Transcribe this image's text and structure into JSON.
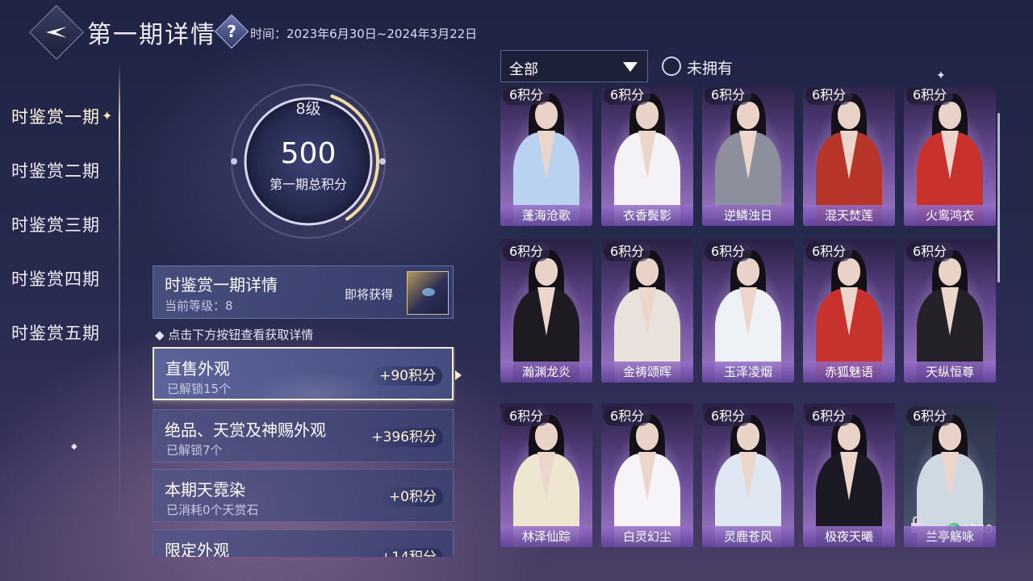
{
  "header": {
    "title": "第一期详情",
    "help_symbol": "?",
    "time_range": "时间：2023年6月30日~2024年3月22日"
  },
  "nav": {
    "items": [
      {
        "label": "时鉴赏一期",
        "active": true
      },
      {
        "label": "时鉴赏二期",
        "active": false
      },
      {
        "label": "时鉴赏三期",
        "active": false
      },
      {
        "label": "时鉴赏四期",
        "active": false
      },
      {
        "label": "时鉴赏五期",
        "active": false
      }
    ]
  },
  "score": {
    "level": "8级",
    "total": "500",
    "label": "第一期总积分",
    "ring_progress": 0.35
  },
  "detail": {
    "title": "时鉴赏一期详情",
    "level": "当前等级：8",
    "soon_label": "即将获得"
  },
  "hint": "◆ 点击下方按钮查看获取详情",
  "categories": [
    {
      "name": "直售外观",
      "sub": "已解锁15个",
      "pts": "+90积分",
      "active": true
    },
    {
      "name": "绝品、天赏及神赐外观",
      "sub": "已解锁7个",
      "pts": "+396积分",
      "active": false
    },
    {
      "name": "本期天霓染",
      "sub": "已消耗0个天赏石",
      "pts": "+0积分",
      "active": false
    },
    {
      "name": "限定外观",
      "sub": "",
      "pts": "+14积分",
      "active": false
    }
  ],
  "filter": {
    "selected": "全部",
    "checkbox_label": "未拥有"
  },
  "cards": [
    {
      "name": "蓬海沧歌",
      "pts": "6积分",
      "robe": "#b9d2f0"
    },
    {
      "name": "衣香鬓影",
      "pts": "6积分",
      "robe": "#f4f2f6"
    },
    {
      "name": "逆鳞浊日",
      "pts": "6积分",
      "robe": "#8d8f9c"
    },
    {
      "name": "混天焚莲",
      "pts": "6积分",
      "robe": "#b8352a"
    },
    {
      "name": "火鸾鸿衣",
      "pts": "6积分",
      "robe": "#c9322c"
    },
    {
      "name": "瀚渊龙炎",
      "pts": "6积分",
      "robe": "#1e1a22"
    },
    {
      "name": "金祷颂晖",
      "pts": "6积分",
      "robe": "#e9e2dc"
    },
    {
      "name": "玉泽凌烟",
      "pts": "6积分",
      "robe": "#eef1f6"
    },
    {
      "name": "赤狐魅语",
      "pts": "6积分",
      "robe": "#c8342d"
    },
    {
      "name": "天纵恒尊",
      "pts": "6积分",
      "robe": "#242128"
    },
    {
      "name": "林泽仙踪",
      "pts": "6积分",
      "robe": "#efe6d2"
    },
    {
      "name": "白灵幻尘",
      "pts": "6积分",
      "robe": "#f6f4f8"
    },
    {
      "name": "灵鹿苍风",
      "pts": "6积分",
      "robe": "#dfe8f2"
    },
    {
      "name": "极夜天曦",
      "pts": "6积分",
      "robe": "#1b1a24"
    },
    {
      "name": "兰亭觞咏",
      "pts": "6积分",
      "robe": "#cfd9e2",
      "price": "2880",
      "locked": true
    }
  ]
}
